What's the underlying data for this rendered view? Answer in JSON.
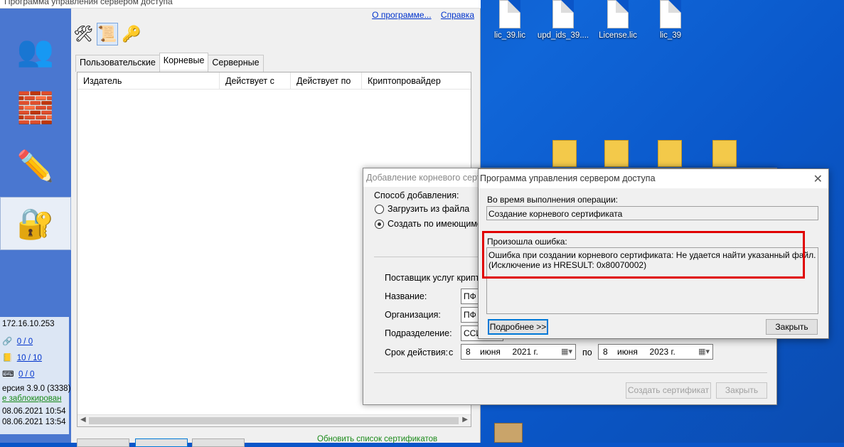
{
  "desktop": {
    "icons": [
      {
        "label": "lic_39.lic",
        "icon": "file-icon"
      },
      {
        "label": "upd_ids_39....",
        "icon": "file-icon"
      },
      {
        "label": "License.lic",
        "icon": "file-icon"
      },
      {
        "label": "lic_39",
        "icon": "file-icon"
      }
    ]
  },
  "app": {
    "title": "Программа управления сервером доступа",
    "links": {
      "about": "О программе...",
      "help": "Справка"
    },
    "toolbar": [
      {
        "icon": "tools-icon"
      },
      {
        "icon": "certificate-icon"
      },
      {
        "icon": "keys-icon"
      }
    ],
    "tabs": [
      "Пользовательские",
      "Корневые",
      "Серверные"
    ],
    "active_tab": "Корневые",
    "columns": [
      "Издатель",
      "Действует с",
      "Действует по",
      "Криптопровайдер"
    ],
    "sidebar_nav": [
      {
        "icon": "users-icon"
      },
      {
        "icon": "firewall-icon"
      },
      {
        "icon": "journal-icon"
      },
      {
        "icon": "key-safe-icon"
      }
    ],
    "info": {
      "ip": "172.16.10.253",
      "count1": "0 / 0",
      "count2": "10 / 10",
      "count3": "0 / 0",
      "version": "ерсия 3.9.0 (3338)",
      "lock_status": "е заблокирован",
      "date1": "08.06.2021 10:54",
      "date2": "08.06.2021 13:54"
    },
    "update_link": "Обновить список сертификатов"
  },
  "add_dialog": {
    "title": "Добавление корневого серт",
    "method_label": "Способ добавления:",
    "options": [
      "Загрузить из файла",
      "Создать по имеющимся с"
    ],
    "selected_option": 1,
    "provider_label": "Поставщик услуг криптог",
    "name_label": "Название:",
    "name_value": "ПФ",
    "org_label": "Организация:",
    "org_value": "ПФ",
    "dept_label": "Подразделение:",
    "dept_value": "ССИ",
    "validity_label": "Срок действия:",
    "from_label": "с",
    "to_label": "по",
    "from_date": {
      "day": "8",
      "month": "июня",
      "year": "2021 г."
    },
    "to_date": {
      "day": "8",
      "month": "июня",
      "year": "2023 г."
    },
    "create_button": "Создать сертификат",
    "close_button": "Закрыть"
  },
  "error_dialog": {
    "title": "Программа управления сервером доступа",
    "operation_label": "Во время выполнения операции:",
    "operation_value": "Создание корневого сертификата",
    "error_label": "Произошла ошибка:",
    "error_line1": "Ошибка при создании корневого сертификата: Не удается найти указанный файл.",
    "error_line2": "(Исключение из HRESULT: 0x80070002)",
    "details_button": "Подробнее >>",
    "close_button": "Закрыть",
    "highlight_color": "#e00000"
  }
}
